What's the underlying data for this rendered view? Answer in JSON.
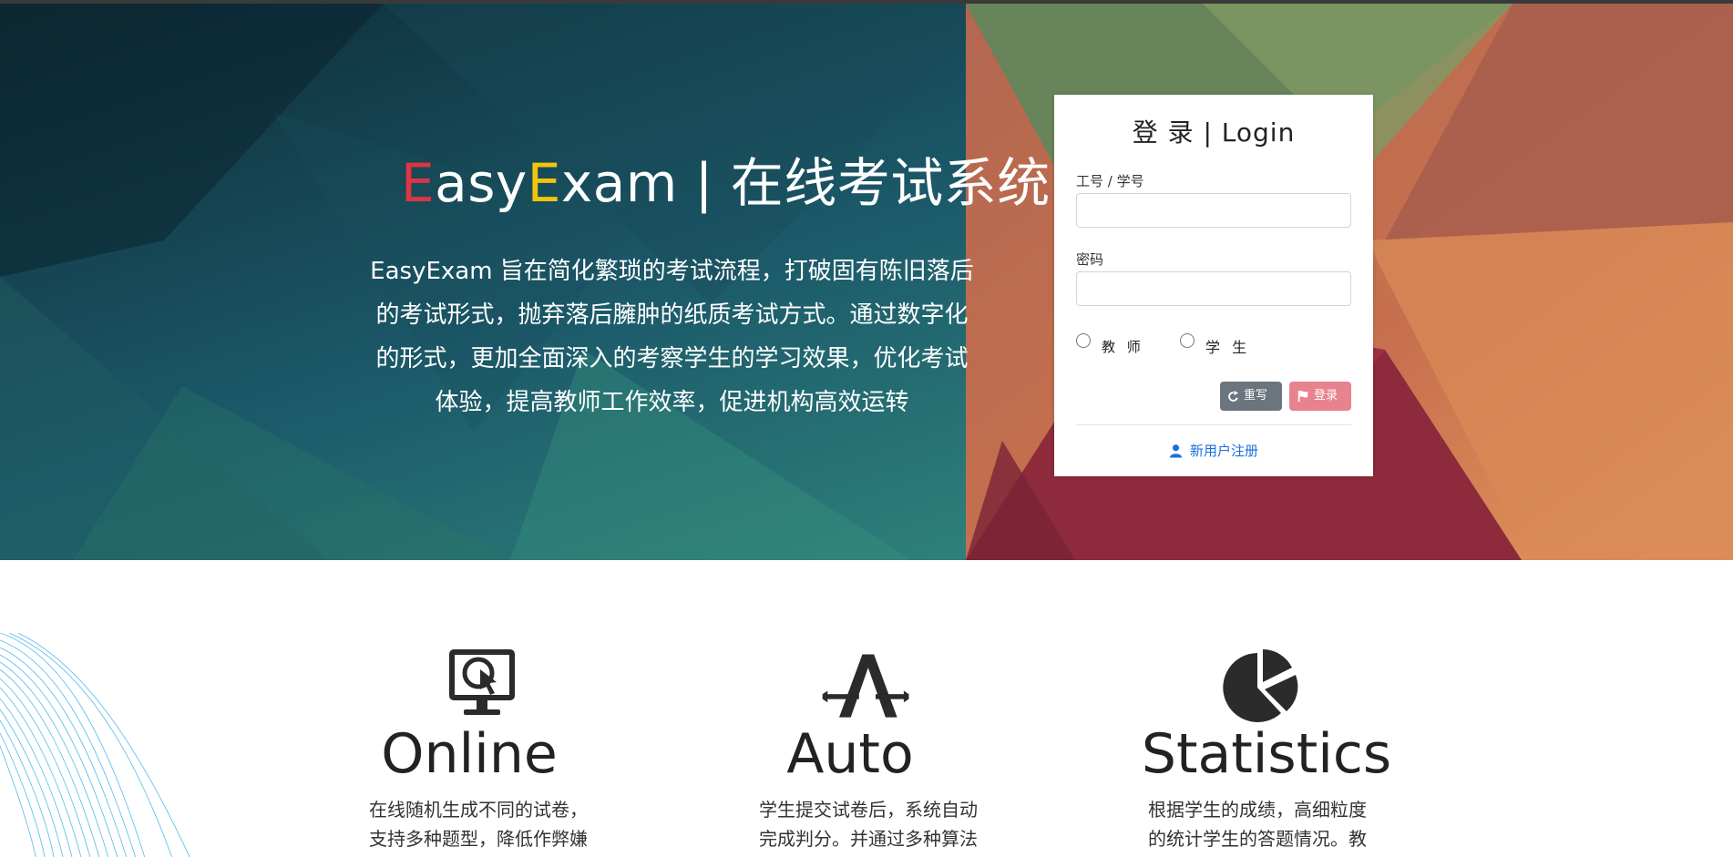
{
  "hero": {
    "brand": {
      "e1": "E",
      "asy": "asy",
      "e2": "E",
      "xam": "xam",
      "suffix": " | 在线考试系统"
    },
    "description": "EasyExam 旨在简化繁琐的考试流程，打破固有陈旧落后的考试形式，抛弃落后臃肿的纸质考试方式。通过数字化的形式，更加全面深入的考察学生的学习效果，优化考试体验，提高教师工作效率，促进机构高效运转"
  },
  "login": {
    "title": "登 录 | Login",
    "id_label": "工号 / 学号",
    "id_value": "",
    "password_label": "密码",
    "password_value": "",
    "role_teacher": "教 师",
    "role_student": "学 生",
    "reset_label": "重写",
    "login_label": "登录",
    "register_label": "新用户注册"
  },
  "features": [
    {
      "icon": "monitor-cursor-icon",
      "title": "Online",
      "desc": "在线随机生成不同的试卷，支持多种题型，降低作弊嫌"
    },
    {
      "icon": "auto-a-icon",
      "title": "Auto",
      "desc": "学生提交试卷后，系统自动完成判分。并通过多种算法"
    },
    {
      "icon": "pie-chart-icon",
      "title": "Statistics",
      "desc": "根据学生的成绩，高细粒度的统计学生的答题情况。教"
    }
  ],
  "colors": {
    "brand_red": "#dc3545",
    "brand_yellow": "#f1c40f",
    "reset_btn": "#6c757d",
    "login_btn": "#e9828f",
    "link": "#1a6fe0"
  }
}
